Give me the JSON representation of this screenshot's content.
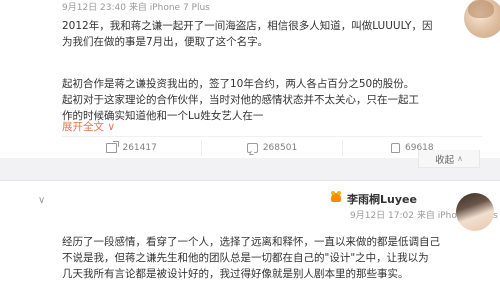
{
  "post1": {
    "meta": "9月12日 23:40 来自 iPhone 7 Plus",
    "paragraph1": [
      "2012年，我和蒋之谦一起开了一间海盗店，相信很多人知道，叫做LUUULY，因",
      "为我们在做的事是7月出，便取了这个名字。"
    ],
    "paragraph2": [
      "起初合作是蒋之谦投资我出的，签了10年合约，两人各占百分之50的股份。",
      "起初对于这家理论的合作伙伴，当时对他的感情状态并不太关心，只在一起工",
      "作的时候确实知道他和一个Lu姓女艺人在一"
    ],
    "expand_label": "展开全文",
    "expand_caret": "∨",
    "actions": {
      "share_count": "261417",
      "comment_count": "268501",
      "like_count": "69618"
    }
  },
  "collapse": {
    "label": "收起",
    "caret": "∧"
  },
  "post2": {
    "chevron": "∨",
    "author": "李雨桐Luyee",
    "meta": "9月12日 17:02 来自 iPhone 7 Plus",
    "paragraph": [
      "经历了一段感情，看穿了一个人，选择了远离和释怀，一直以来做的都是低调自己",
      "不说是我，但蒋之谦先生和他的团队总是一切都在自己的\"设计\"之中，让我以为",
      "几天我所有言论都是被设计好的，我过得好像就是别人剧本里的那些事实。"
    ]
  },
  "colors": {
    "accent": "#eb7350",
    "text": "#333333",
    "muted": "#999999"
  },
  "icons": {
    "share": "share-icon",
    "comment": "comment-icon",
    "like": "like-icon",
    "vip": "vip-heart-icon"
  }
}
